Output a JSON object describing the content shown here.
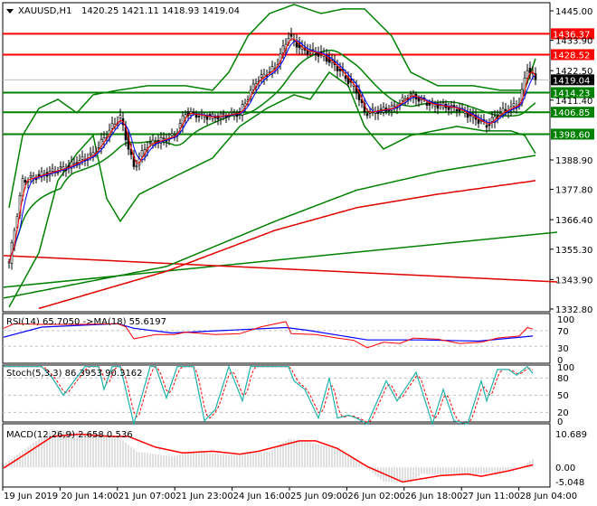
{
  "header": {
    "symbol": "XAUUSD,H1",
    "ohlc": "1420.25 1421.11 1418.93 1419.04"
  },
  "price_axis": [
    "1445.00",
    "1433.90",
    "1422.50",
    "1411.40",
    "1388.90",
    "1377.80",
    "1366.40",
    "1355.30",
    "1343.90",
    "1332.80"
  ],
  "price_axis_values": [
    1445.0,
    1433.9,
    1422.5,
    1411.4,
    1388.9,
    1377.8,
    1366.4,
    1355.3,
    1343.9,
    1332.8
  ],
  "levels": [
    {
      "label": "1436.37",
      "value": 1436.37,
      "color": "#ff0000"
    },
    {
      "label": "1428.52",
      "value": 1428.52,
      "color": "#ff0000"
    },
    {
      "label": "1414.23",
      "value": 1414.23,
      "color": "#008000"
    },
    {
      "label": "1406.85",
      "value": 1406.85,
      "color": "#008000"
    },
    {
      "label": "1398.60",
      "value": 1398.6,
      "color": "#008000"
    }
  ],
  "current_price": {
    "label": "1419.04",
    "value": 1419.04
  },
  "time_axis": [
    "19 Jun 2019",
    "20 Jun 14:00",
    "21 Jun 07:00",
    "21 Jun 23:00",
    "24 Jun 16:00",
    "25 Jun 09:00",
    "26 Jun 02:00",
    "26 Jun 18:00",
    "27 Jun 11:00",
    "28 Jun 04:00"
  ],
  "rsi": {
    "title": "RSI(14) 65.7050  ->MA(18) 55.6197",
    "axis": [
      "100",
      "70",
      "30",
      "0"
    ]
  },
  "stoch": {
    "title": "Stoch(5,3,3) 86.3953 90.3162",
    "axis": [
      "100",
      "80",
      "50",
      "20",
      "0"
    ]
  },
  "macd": {
    "title": "MACD(12,26,9) 2.658 0.536",
    "axis": [
      "10.689",
      "0.00",
      "-5.048"
    ]
  },
  "chart_data": {
    "type": "line",
    "x_unit": "bar index",
    "price_close": [
      [
        2,
        1350.5
      ],
      [
        7,
        1381
      ],
      [
        13,
        1383
      ],
      [
        23,
        1386
      ],
      [
        33,
        1391
      ],
      [
        40,
        1401.5
      ],
      [
        43,
        1405
      ],
      [
        48,
        1386
      ],
      [
        53,
        1394.7
      ],
      [
        63,
        1398
      ],
      [
        67,
        1406.6
      ],
      [
        77,
        1405
      ],
      [
        87,
        1406.6
      ],
      [
        93,
        1418.5
      ],
      [
        100,
        1423.6
      ],
      [
        105,
        1435.5
      ],
      [
        110,
        1430.4
      ],
      [
        117,
        1428.7
      ],
      [
        123,
        1423.6
      ],
      [
        130,
        1415
      ],
      [
        133,
        1406.6
      ],
      [
        143,
        1408.3
      ],
      [
        150,
        1413.4
      ],
      [
        157,
        1410
      ],
      [
        167,
        1408.3
      ],
      [
        173,
        1405
      ],
      [
        178,
        1402
      ],
      [
        183,
        1406.6
      ],
      [
        190,
        1410
      ],
      [
        193,
        1423.6
      ],
      [
        196,
        1419
      ]
    ],
    "bb_upper": [
      [
        2,
        1370.9
      ],
      [
        7,
        1398.1
      ],
      [
        13,
        1408.3
      ],
      [
        20,
        1411.7
      ],
      [
        27,
        1406.6
      ],
      [
        33,
        1413.4
      ],
      [
        42,
        1415.1
      ],
      [
        53,
        1416.8
      ],
      [
        67,
        1416.8
      ],
      [
        77,
        1415.1
      ],
      [
        83,
        1421.9
      ],
      [
        90,
        1435.5
      ],
      [
        98,
        1444
      ],
      [
        107,
        1447.4
      ],
      [
        117,
        1444
      ],
      [
        125,
        1445.7
      ],
      [
        133,
        1445.7
      ],
      [
        143,
        1435.5
      ],
      [
        150,
        1421.9
      ],
      [
        160,
        1416.8
      ],
      [
        173,
        1416.8
      ],
      [
        183,
        1415.1
      ],
      [
        192,
        1415.1
      ],
      [
        196,
        1427
      ]
    ],
    "bb_lower": [
      [
        2,
        1333.5
      ],
      [
        13,
        1353.9
      ],
      [
        20,
        1381.1
      ],
      [
        27,
        1391.3
      ],
      [
        33,
        1398.1
      ],
      [
        38,
        1374.3
      ],
      [
        43,
        1365.8
      ],
      [
        50,
        1376
      ],
      [
        60,
        1381.1
      ],
      [
        77,
        1389.6
      ],
      [
        87,
        1401.5
      ],
      [
        97,
        1408.3
      ],
      [
        107,
        1413.4
      ],
      [
        113,
        1411.7
      ],
      [
        120,
        1421.9
      ],
      [
        127,
        1416.8
      ],
      [
        133,
        1401.5
      ],
      [
        140,
        1393
      ],
      [
        150,
        1398.1
      ],
      [
        167,
        1401.5
      ],
      [
        177,
        1399.8
      ],
      [
        187,
        1399.8
      ],
      [
        192,
        1398.1
      ],
      [
        196,
        1391.3
      ]
    ],
    "ma_green_long": [
      [
        0,
        1336.9
      ],
      [
        60,
        1348.8
      ],
      [
        100,
        1365.8
      ],
      [
        130,
        1377.5
      ],
      [
        160,
        1384.5
      ],
      [
        196,
        1390.6
      ]
    ],
    "ma_red_long": [
      [
        13,
        1333
      ],
      [
        60,
        1347
      ],
      [
        100,
        1362.4
      ],
      [
        130,
        1370.9
      ],
      [
        160,
        1376
      ],
      [
        196,
        1381.1
      ]
    ],
    "trend_green": [
      [
        0,
        1341
      ],
      [
        204,
        1361.7
      ]
    ],
    "trend_red": [
      [
        0,
        1352.9
      ],
      [
        204,
        1343
      ]
    ],
    "rsi_line": [
      [
        0,
        76
      ],
      [
        4,
        88
      ],
      [
        14,
        86
      ],
      [
        28,
        86
      ],
      [
        42,
        88
      ],
      [
        45,
        80
      ],
      [
        48,
        49
      ],
      [
        56,
        60
      ],
      [
        63,
        60
      ],
      [
        67,
        66
      ],
      [
        78,
        60
      ],
      [
        87,
        62
      ],
      [
        95,
        80
      ],
      [
        104,
        93
      ],
      [
        106,
        62
      ],
      [
        115,
        60
      ],
      [
        123,
        51
      ],
      [
        129,
        45
      ],
      [
        134,
        26
      ],
      [
        140,
        40
      ],
      [
        146,
        37
      ],
      [
        151,
        51
      ],
      [
        160,
        48
      ],
      [
        168,
        37
      ],
      [
        176,
        40
      ],
      [
        182,
        51
      ],
      [
        190,
        56
      ],
      [
        193,
        78
      ],
      [
        195,
        74
      ]
    ],
    "rsi_ma": [
      [
        0,
        53
      ],
      [
        14,
        79
      ],
      [
        42,
        88
      ],
      [
        48,
        76
      ],
      [
        62,
        64
      ],
      [
        104,
        78
      ],
      [
        112,
        71
      ],
      [
        134,
        46
      ],
      [
        154,
        46
      ],
      [
        175,
        43
      ],
      [
        195,
        56
      ]
    ],
    "stoch_main": [
      [
        0,
        100
      ],
      [
        14,
        100
      ],
      [
        18,
        80
      ],
      [
        22,
        50
      ],
      [
        26,
        75
      ],
      [
        30,
        100
      ],
      [
        35,
        100
      ],
      [
        37,
        60
      ],
      [
        40,
        100
      ],
      [
        43,
        100
      ],
      [
        48,
        0
      ],
      [
        54,
        100
      ],
      [
        56,
        100
      ],
      [
        60,
        45
      ],
      [
        64,
        100
      ],
      [
        70,
        100
      ],
      [
        74,
        5
      ],
      [
        78,
        25
      ],
      [
        83,
        100
      ],
      [
        88,
        40
      ],
      [
        91,
        100
      ],
      [
        98,
        100
      ],
      [
        105,
        100
      ],
      [
        107,
        75
      ],
      [
        111,
        60
      ],
      [
        116,
        10
      ],
      [
        120,
        80
      ],
      [
        123,
        10
      ],
      [
        127,
        15
      ],
      [
        130,
        10
      ],
      [
        134,
        0
      ],
      [
        141,
        75
      ],
      [
        145,
        40
      ],
      [
        152,
        90
      ],
      [
        158,
        0
      ],
      [
        162,
        60
      ],
      [
        166,
        5
      ],
      [
        171,
        0
      ],
      [
        176,
        75
      ],
      [
        178,
        40
      ],
      [
        182,
        95
      ],
      [
        186,
        95
      ],
      [
        189,
        85
      ],
      [
        193,
        100
      ],
      [
        195,
        88
      ]
    ],
    "macd_signal": [
      [
        0,
        -0.2
      ],
      [
        8,
        4.2
      ],
      [
        18,
        9.8
      ],
      [
        28,
        10.5
      ],
      [
        39,
        9.8
      ],
      [
        46,
        9.8
      ],
      [
        56,
        6.4
      ],
      [
        66,
        4.6
      ],
      [
        77,
        5.1
      ],
      [
        87,
        4.2
      ],
      [
        94,
        5.1
      ],
      [
        109,
        8.4
      ],
      [
        115,
        8.4
      ],
      [
        123,
        6
      ],
      [
        134,
        0.3
      ],
      [
        147,
        -4.6
      ],
      [
        161,
        -2.6
      ],
      [
        171,
        -2.1
      ],
      [
        176,
        -2.8
      ],
      [
        186,
        -1.1
      ],
      [
        195,
        0.8
      ]
    ],
    "macd_hist": [
      [
        0,
        1
      ],
      [
        18,
        12
      ],
      [
        42,
        10
      ],
      [
        49,
        5
      ],
      [
        62,
        3.5
      ],
      [
        70,
        4.8
      ],
      [
        84,
        4
      ],
      [
        98,
        5
      ],
      [
        105,
        9
      ],
      [
        112,
        8
      ],
      [
        123,
        6
      ],
      [
        132,
        1
      ],
      [
        140,
        -4.5
      ],
      [
        150,
        -5
      ],
      [
        154,
        -2
      ],
      [
        168,
        -2.6
      ],
      [
        182,
        -1.5
      ],
      [
        190,
        0
      ],
      [
        195,
        2.6
      ]
    ]
  }
}
